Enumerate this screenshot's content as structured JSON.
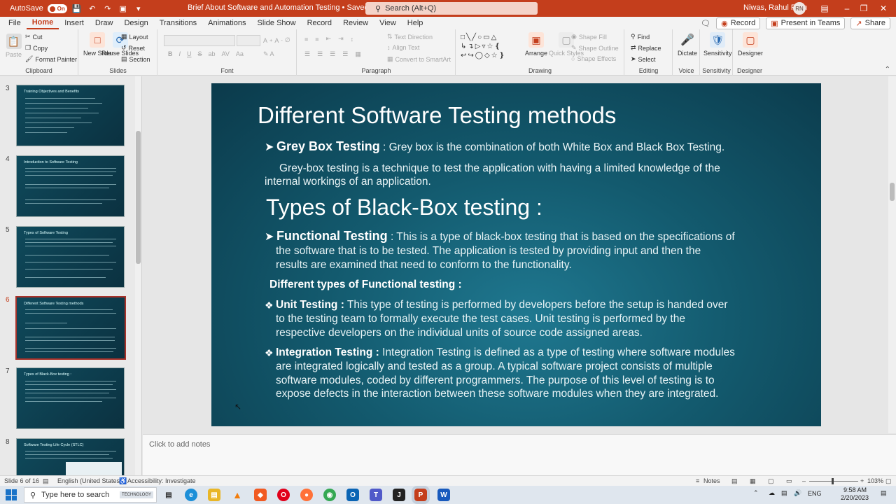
{
  "titlebar": {
    "autosave_label": "AutoSave",
    "autosave_state": "On",
    "doc_title": "Brief About Software and Automation Testing • Saved",
    "search_placeholder": "Search (Alt+Q)",
    "user_name": "Niwas, Rahul Ram",
    "user_initials": "RN"
  },
  "ribbon_tabs": [
    "File",
    "Home",
    "Insert",
    "Draw",
    "Design",
    "Transitions",
    "Animations",
    "Slide Show",
    "Record",
    "Review",
    "View",
    "Help"
  ],
  "active_tab": "Home",
  "ribbon_right": {
    "record": "Record",
    "present": "Present in Teams",
    "share": "Share"
  },
  "ribbon": {
    "clipboard": {
      "label": "Clipboard",
      "paste": "Paste",
      "cut": "Cut",
      "copy": "Copy",
      "format_painter": "Format Painter"
    },
    "slides": {
      "label": "Slides",
      "new_slide": "New Slide",
      "reuse_slides": "Reuse Slides",
      "layout": "Layout",
      "reset": "Reset",
      "section": "Section"
    },
    "font": {
      "label": "Font"
    },
    "paragraph": {
      "label": "Paragraph",
      "text_direction": "Text Direction",
      "align_text": "Align Text",
      "convert_smartart": "Convert to SmartArt"
    },
    "drawing": {
      "label": "Drawing",
      "arrange": "Arrange",
      "quick_styles": "Quick Styles",
      "shape_fill": "Shape Fill",
      "shape_outline": "Shape Outline",
      "shape_effects": "Shape Effects"
    },
    "editing": {
      "label": "Editing",
      "find": "Find",
      "replace": "Replace",
      "select": "Select"
    },
    "voice": {
      "label": "Voice",
      "dictate": "Dictate"
    },
    "sensitivity": {
      "label": "Sensitivity",
      "button": "Sensitivity"
    },
    "designer": {
      "label": "Designer",
      "button": "Designer"
    }
  },
  "thumbnails": [
    {
      "number": "3",
      "title": "Training Objectives and Benefits",
      "selected": false
    },
    {
      "number": "4",
      "title": "Introduction to Software Testing",
      "selected": false
    },
    {
      "number": "5",
      "title": "Types of Software Testing",
      "selected": false
    },
    {
      "number": "6",
      "title": "Different Software Testing methods",
      "selected": true
    },
    {
      "number": "7",
      "title": "Types of Black-Box testing :",
      "selected": false
    },
    {
      "number": "8",
      "title": "Software Testing Life Cycle (STLC)",
      "selected": false
    }
  ],
  "slide": {
    "title": "Different Software Testing methods",
    "grey_box_term": "Grey Box Testing",
    "grey_box_def": " : Grey box is the combination of both White Box and Black Box Testing.",
    "grey_box_para_1": "Grey-box testing is a technique to test the application with having a limited knowledge of the",
    "grey_box_para_2": "internal workings of an application.",
    "types_heading": "Types of Black-Box testing :",
    "functional_term": "Functional Testing",
    "functional_line_1": " : This is a type of black-box testing that is based on the specifications of",
    "functional_line_2": "the software that is to be tested. The application is tested by providing input and then the",
    "functional_line_3": "results are examined that need to conform to the functionality.",
    "functional_types_heading": "Different types of Functional testing :",
    "unit_term": "Unit Testing :",
    "unit_line_1": " This type of testing is performed by developers before the setup is handed over",
    "unit_line_2": "to the testing team to formally execute the test cases. Unit testing is performed by the",
    "unit_line_3": "respective developers on the individual units of source code assigned areas.",
    "integration_term": "Integration Testing :",
    "integration_line_1": " Integration Testing is defined as a type of testing where software modules",
    "integration_line_2": "are integrated logically and tested as a group. A typical software project consists of multiple",
    "integration_line_3": "software modules, coded by different programmers. The purpose of this level of testing is to",
    "integration_line_4": "expose defects in the interaction between these software modules when they are integrated."
  },
  "notes_placeholder": "Click to add notes",
  "status": {
    "slide_of": "Slide 6 of 16",
    "language": "English (United States)",
    "accessibility": "Accessibility: Investigate",
    "notes": "Notes",
    "zoom": "103%"
  },
  "taskbar": {
    "search_placeholder": "Type here to search",
    "badge": "TECHNOLOGY",
    "language": "ENG",
    "time": "9:58 AM",
    "date": "2/20/2023"
  },
  "colors": {
    "accent": "#c43e1c",
    "slide_bg": "#135a6e"
  }
}
